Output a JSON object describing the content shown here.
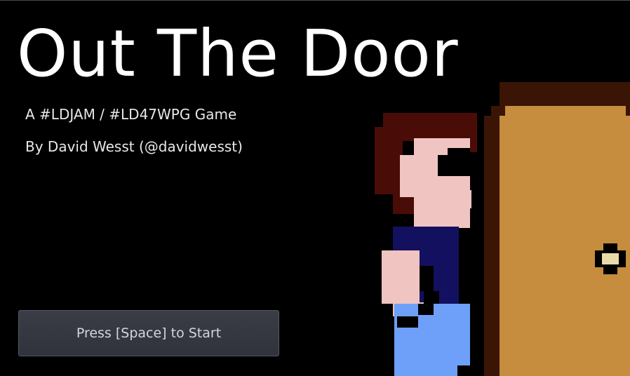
{
  "game": {
    "title": "Out The Door",
    "subtitle_line1": "A #LDJAM / #LD47WPG Game",
    "subtitle_line2": "By David Wesst (@davidwesst)",
    "start_button_label": "Press [Space] to Start"
  },
  "palette": {
    "background": "#000000",
    "hair": "#4a0c06",
    "skin": "#f0c4c0",
    "shirt": "#141060",
    "pants": "#6ea0fa",
    "door": "#c68d3e",
    "door_frame": "#3a1506",
    "knob": "#e8dca8",
    "outline": "#000000"
  }
}
